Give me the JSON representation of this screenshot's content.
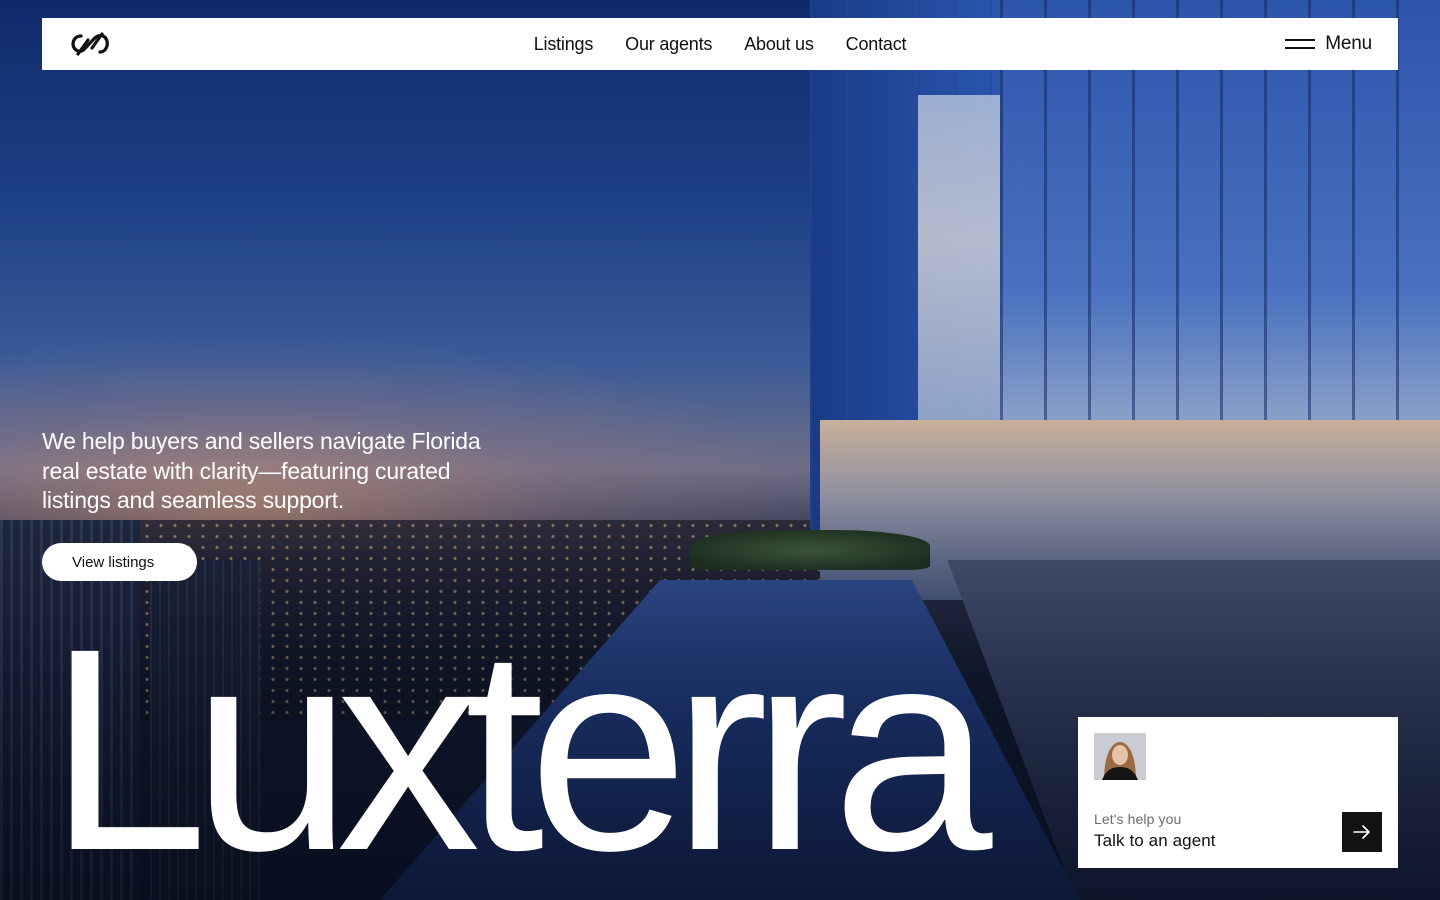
{
  "brand": {
    "logo_icon": "infinity-link-logo-icon",
    "wordmark": "Luxterra"
  },
  "nav": {
    "links": [
      {
        "label": "Listings"
      },
      {
        "label": "Our agents"
      },
      {
        "label": "About us"
      },
      {
        "label": "Contact"
      }
    ],
    "menu_label": "Menu",
    "menu_icon": "hamburger-icon"
  },
  "hero": {
    "tagline": "We help buyers and sellers navigate Florida real estate with clarity—featuring curated listings and seamless support.",
    "cta_label": "View listings"
  },
  "agent_card": {
    "kicker": "Let's help you",
    "title": "Talk to an agent",
    "arrow_icon": "arrow-right-icon"
  },
  "colors": {
    "nav_bg": "#ffffff",
    "text_dark": "#111111",
    "cta_bg": "#ffffff",
    "arrow_button_bg": "#121212"
  }
}
